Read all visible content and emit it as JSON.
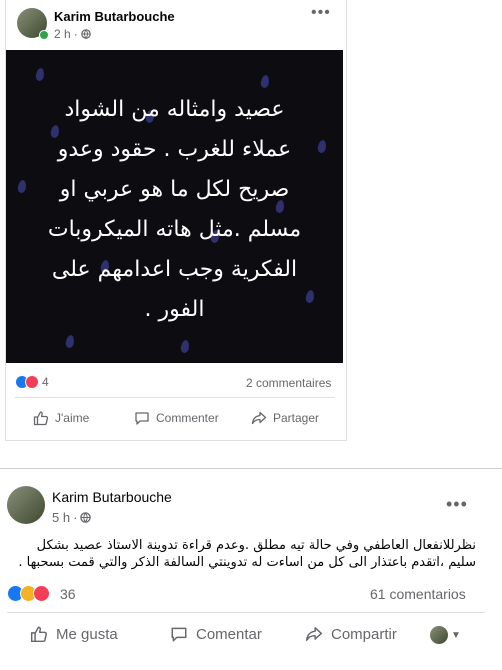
{
  "post1": {
    "author": "Karim Butarbouche",
    "time": "2 h",
    "image_text": "عصيد وامثاله من الشواد\nعملاء للغرب . حقود وعدو\nصريح لكل ما هو عربي او\nمسلم .مثل هاته الميكروبات\nالفكرية وجب اعدامهم على\nالفور .",
    "reaction_count": "4",
    "comments": "2 commentaires",
    "like_label": "J'aime",
    "comment_label": "Commenter",
    "share_label": "Partager"
  },
  "post2": {
    "author": "Karim Butarbouche",
    "time": "5 h",
    "body": "نظرللانفعال العاطفي وفي حالة تيه مطلق .وعدم قراءة تدوينة الاستاذ عصيد بشكل سليم ،اتقدم باعتذار  الى كل من اساءت له تدوينتي السالفة الذكر والتي قمت بسحبها .",
    "reaction_count": "36",
    "comments": "61 comentarios",
    "like_label": "Me gusta",
    "comment_label": "Comentar",
    "share_label": "Compartir"
  },
  "colors": {
    "like_blue": "#1877f2",
    "love_red": "#f33e58",
    "haha_yellow": "#f7b125",
    "online_green": "#31a24c",
    "muted_text": "#65676b"
  },
  "icons": [
    "globe-icon",
    "more-icon",
    "like-icon",
    "love-icon",
    "haha-icon",
    "comment-icon",
    "share-icon",
    "chevron-down-icon"
  ]
}
